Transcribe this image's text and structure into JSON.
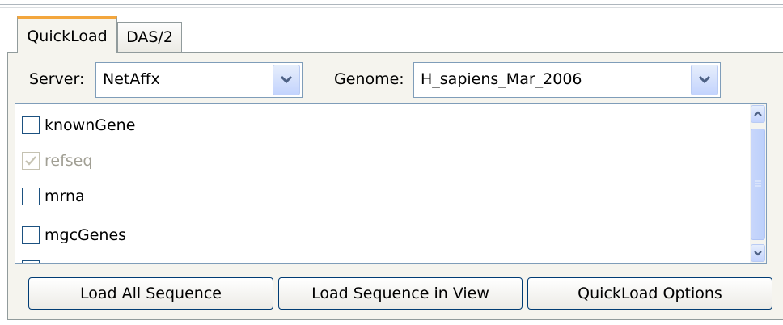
{
  "tabs": [
    {
      "label": "QuickLoad"
    },
    {
      "label": "DAS/2"
    }
  ],
  "server": {
    "label": "Server:",
    "value": "NetAffx"
  },
  "genome": {
    "label": "Genome:",
    "value": "H_sapiens_Mar_2006"
  },
  "items": [
    {
      "label": "knownGene",
      "checked": false,
      "enabled": true
    },
    {
      "label": "refseq",
      "checked": true,
      "enabled": false
    },
    {
      "label": "mrna",
      "checked": false,
      "enabled": true
    },
    {
      "label": "mgcGenes",
      "checked": false,
      "enabled": true
    }
  ],
  "buttons": {
    "load_all": "Load All Sequence",
    "load_view": "Load Sequence in View",
    "options": "QuickLoad Options"
  },
  "colors": {
    "accent_tab": "#f3a63d",
    "panel_bg": "#f5f4ee",
    "border": "#7f9db9"
  }
}
